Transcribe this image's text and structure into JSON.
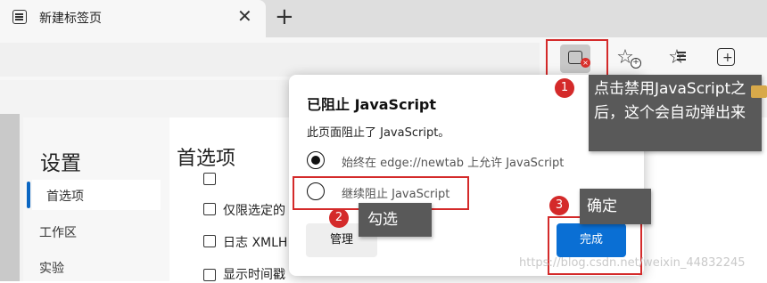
{
  "tab": {
    "title": "新建标签页",
    "close": "✕",
    "new_tab": "+"
  },
  "toolbar": {
    "js_blocked_icon": "js-blocked-icon",
    "icons": [
      "add-favorite-icon",
      "favorites-icon",
      "collections-icon"
    ]
  },
  "settings": {
    "title": "设置",
    "nav": [
      "首选项",
      "工作区",
      "实验"
    ],
    "page_title": "首选项",
    "options": [
      "",
      "仅限选定的",
      "日志 XMLH",
      "显示时间戳"
    ]
  },
  "popup": {
    "title": "已阻止 JavaScript",
    "description": "此页面阻止了 JavaScript。",
    "radio_allow": "始终在 edge://newtab 上允许 JavaScript",
    "radio_block": "继续阻止 JavaScript",
    "manage_label": "管理",
    "done_label": "完成",
    "selected_option": "始终在 edge://newtab 上允许 JavaScript"
  },
  "annotations": {
    "badge1": "1",
    "badge2": "2",
    "badge3": "3",
    "callout1": "点击禁用JavaScript之后，这个会自动弹出来",
    "callout2": "勾选",
    "callout3": "确定",
    "highlight_color": "#d42a2a"
  },
  "watermark": "https://blog.csdn.net/weixin_44832245",
  "colors": {
    "accent": "#0a6fd4",
    "nav_indicator": "#0a66c2",
    "callout_bg": "#595959"
  }
}
